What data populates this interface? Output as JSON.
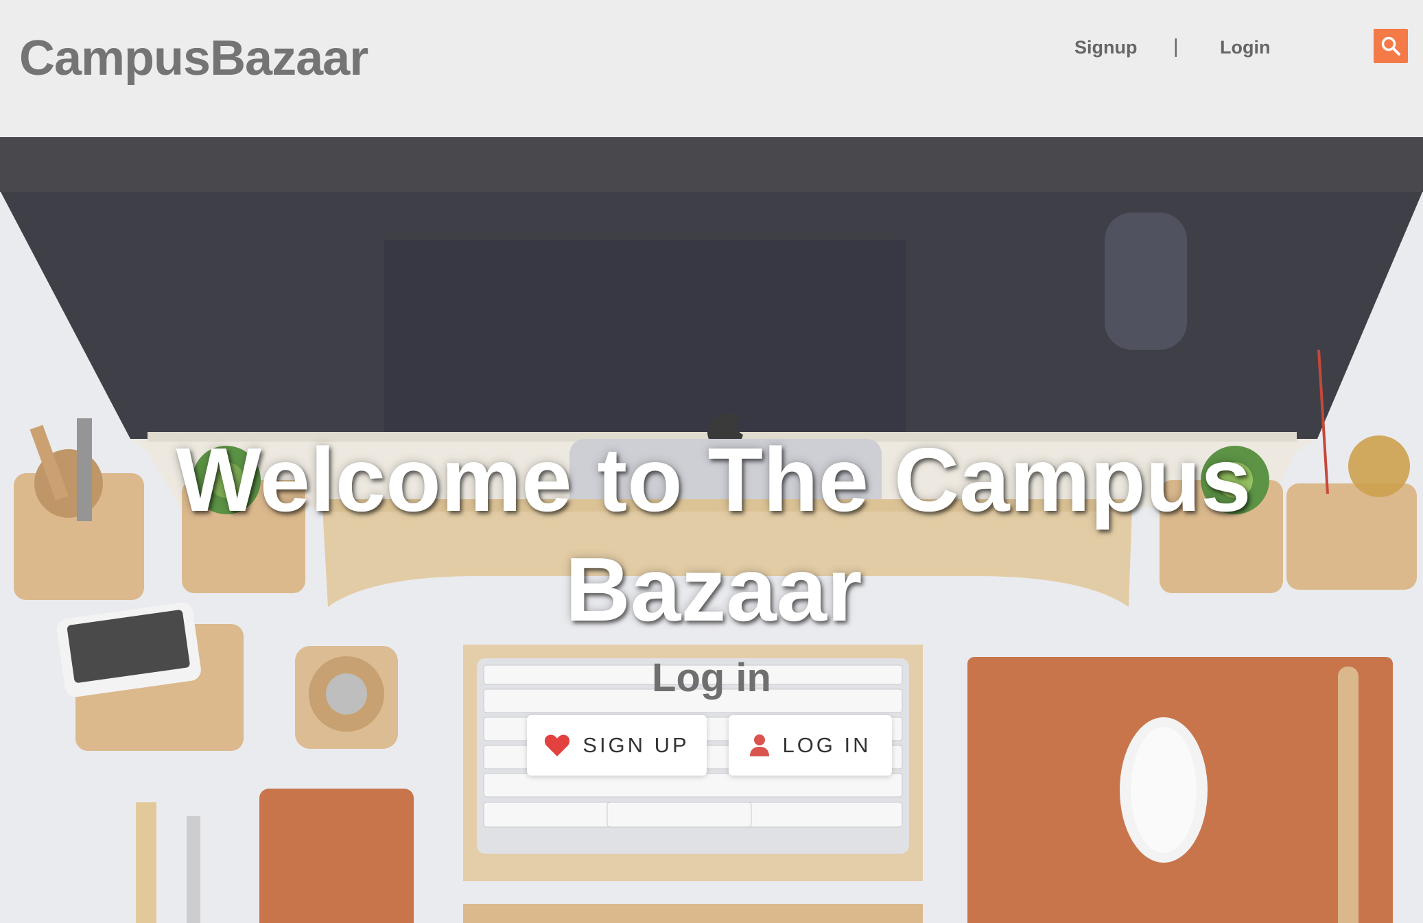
{
  "header": {
    "brand": "CampusBazaar",
    "nav": {
      "signup_label": "Signup",
      "separator": "|",
      "login_label": "Login"
    },
    "search_icon": "search-icon"
  },
  "hero": {
    "title": "Welcome to The Campus Bazaar",
    "subtitle": "Log in",
    "buttons": {
      "signup_label": "SIGN UP",
      "signup_icon": "heart-icon",
      "login_label": "LOG IN",
      "login_icon": "user-icon"
    },
    "background": "desk-workspace-photo"
  },
  "colors": {
    "accent": "#f47a47",
    "heart": "#e2413f",
    "user": "#d9534f",
    "brand_text": "#747474"
  }
}
